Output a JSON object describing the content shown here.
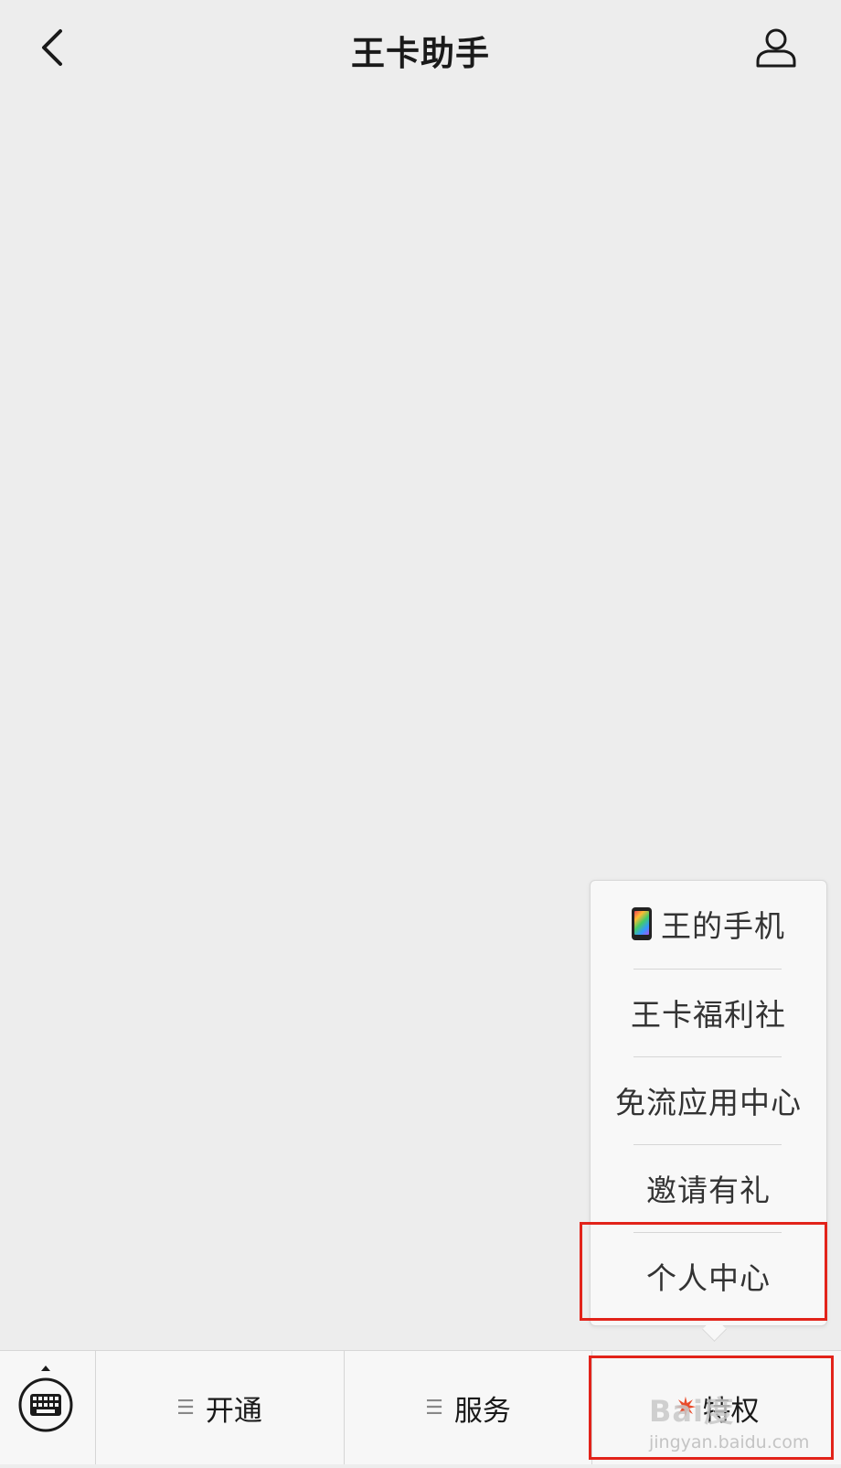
{
  "nav": {
    "back_icon": "chevron-left-icon",
    "title": "王卡助手",
    "user_icon": "user-icon"
  },
  "popup_menu": {
    "items": [
      {
        "label": "王的手机",
        "icon": "phone-emoji-icon"
      },
      {
        "label": "王卡福利社"
      },
      {
        "label": "免流应用中心"
      },
      {
        "label": "邀请有礼"
      },
      {
        "label": "个人中心"
      }
    ]
  },
  "tabbar": {
    "keyboard_icon": "keyboard-icon",
    "tabs": [
      {
        "label": "开通",
        "icon": "menu-lines-icon"
      },
      {
        "label": "服务",
        "icon": "menu-lines-icon"
      },
      {
        "label": "特权",
        "icon": "sparkle-icon"
      }
    ]
  },
  "annotation": {
    "highlight_color": "#e2231a"
  },
  "watermark": {
    "logo": "Bai度",
    "url": "jingyan.baidu.com"
  }
}
